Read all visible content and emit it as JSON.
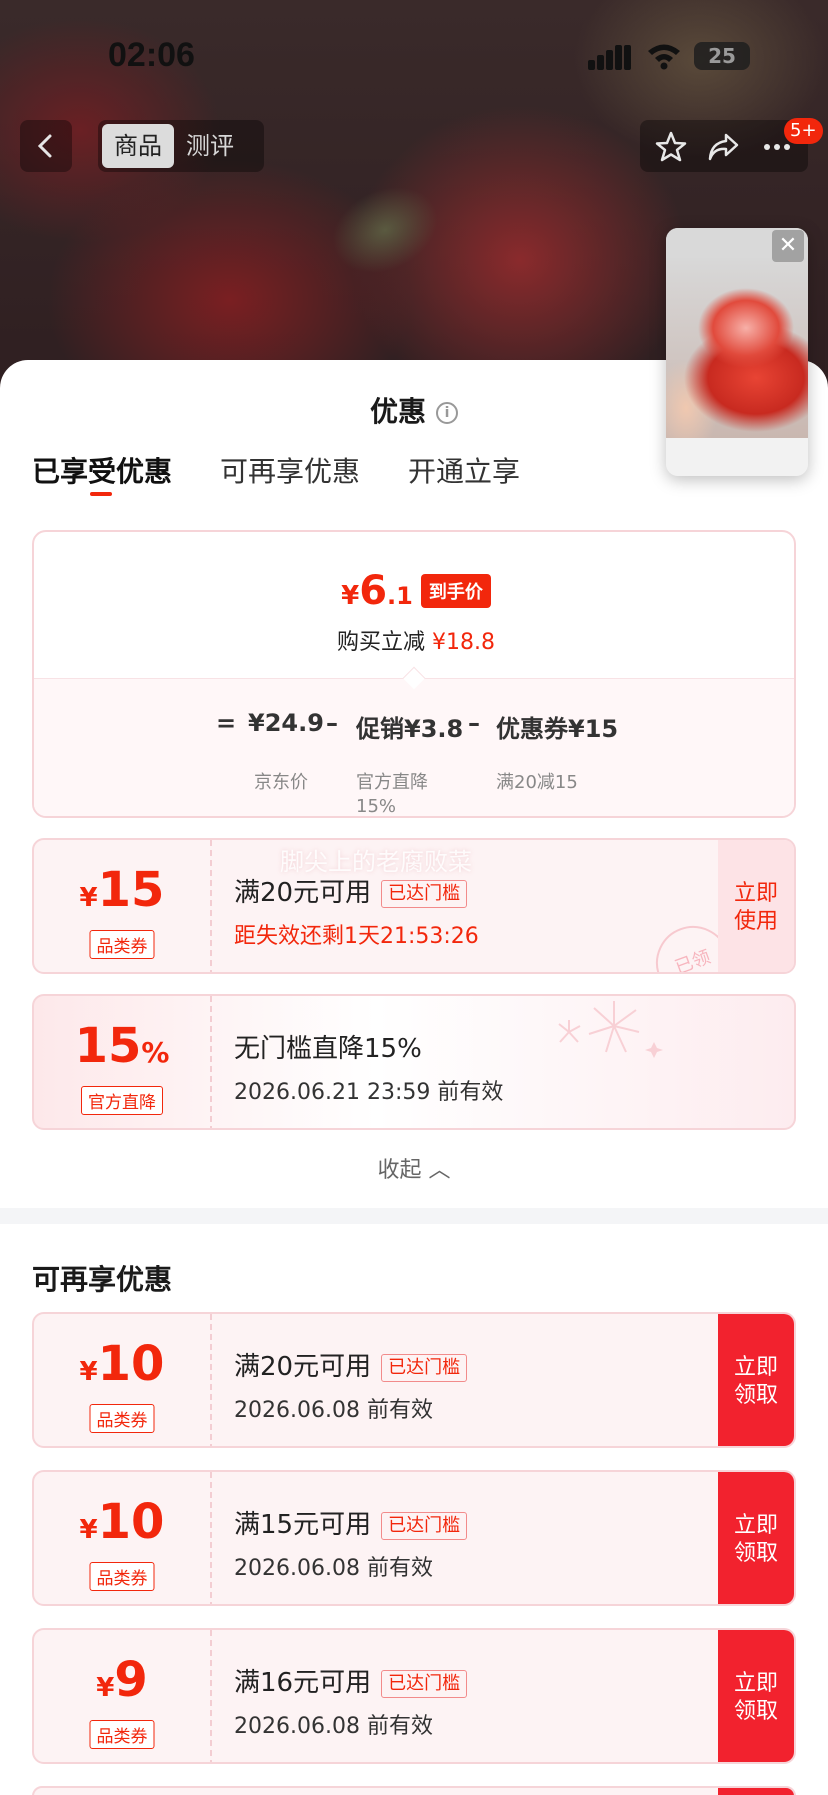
{
  "status_bar": {
    "time": "02:06",
    "battery": "25"
  },
  "nav": {
    "tabs": [
      {
        "label": "商品",
        "active": true
      },
      {
        "label": "测评",
        "active": false
      }
    ],
    "badge": "5+"
  },
  "sheet": {
    "title": "优惠",
    "tabs": [
      {
        "label": "已享受优惠",
        "active": true
      },
      {
        "label": "可再享优惠",
        "active": false
      },
      {
        "label": "开通立享",
        "active": false
      }
    ],
    "summary": {
      "currency": "¥",
      "price_int": "6",
      "price_dec": ".1",
      "price_tag": "到手价",
      "reduce_label": "购买立减",
      "reduce_value": "¥18.8",
      "formula": {
        "equals": "=",
        "base": "¥24.9",
        "minus1": "–",
        "promo": "促销¥3.8",
        "minus2": "–",
        "coupon": "优惠券¥15"
      },
      "labels": {
        "base": "京东价",
        "promo": "官方直降\n15%",
        "coupon": "满20减15"
      }
    },
    "applied_coupons": [
      {
        "currency": "¥",
        "amount": "15",
        "kind": "品类券",
        "condition": "满20元可用",
        "pill": "已达门槛",
        "sub": "距失效还剩1天21:53:26",
        "action": "立即\n使用",
        "stamp": "已领"
      },
      {
        "amount": "15",
        "unit": "%",
        "kind": "官方直降",
        "condition": "无门槛直降15%",
        "sub": "2026.06.21 23:59 前有效"
      }
    ],
    "watermark": "脚尖上的老腐败菜",
    "collapse": "收起 ︿",
    "more_title": "可再享优惠",
    "more_coupons": [
      {
        "currency": "¥",
        "amount": "10",
        "kind": "品类券",
        "condition": "满20元可用",
        "pill": "已达门槛",
        "sub": "2026.06.08 前有效",
        "action": "立即\n领取"
      },
      {
        "currency": "¥",
        "amount": "10",
        "kind": "品类券",
        "condition": "满15元可用",
        "pill": "已达门槛",
        "sub": "2026.06.08 前有效",
        "action": "立即\n领取"
      },
      {
        "currency": "¥",
        "amount": "9",
        "kind": "品类券",
        "condition": "满16元可用",
        "pill": "已达门槛",
        "sub": "2026.06.08 前有效",
        "action": "立即\n领取"
      }
    ]
  },
  "colors": {
    "accent": "#f2270c",
    "button_red": "#f2222e",
    "border_pink": "#f6d4d8"
  }
}
